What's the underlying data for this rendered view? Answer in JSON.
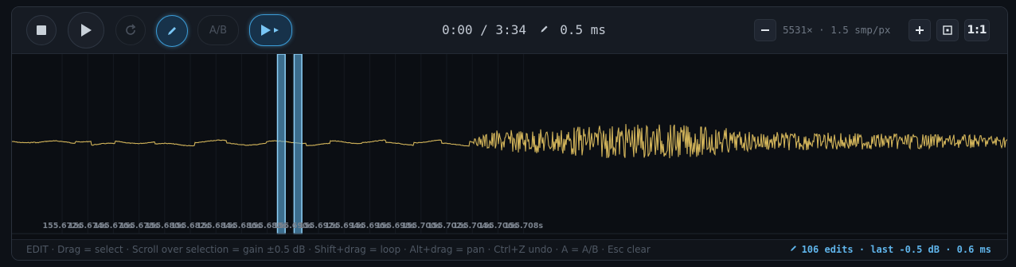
{
  "toolbar": {
    "ab_label": "A/B",
    "time": "0:00 / 3:34",
    "edit_step": "0.5 ms",
    "zoom_label": "5531× · 1.5 smp/px",
    "one_to_one_label": "1:1"
  },
  "icons": {
    "stop": "stop-icon",
    "play": "play-icon",
    "loop": "loop-icon",
    "pencil": "pencil-icon",
    "play_next": "play-next-icon",
    "minus": "minus-icon",
    "plus": "plus-icon",
    "fit": "fit-icon"
  },
  "colors": {
    "waveform": "#d2b45a",
    "selection": "#5aa8d8",
    "accent": "#58b4f0",
    "background": "#0b0e13"
  },
  "chart_data": {
    "type": "line",
    "x_unit": "s",
    "tick_labels": [
      "155.672s",
      "155.674s",
      "155.676s",
      "155.678s",
      "155.680s",
      "155.682s",
      "155.684s",
      "155.686s",
      "155.688s",
      "155.690s",
      "155.692s",
      "155.694s",
      "155.696s",
      "155.698s",
      "155.700s",
      "155.702s",
      "155.704s",
      "155.706s",
      "155.708s"
    ],
    "selections": [
      {
        "start": 155.6888,
        "end": 155.6894
      },
      {
        "start": 155.6901,
        "end": 155.6907
      }
    ]
  },
  "status": {
    "hint": "EDIT · Drag = select · Scroll over selection = gain ±0.5 dB · Shift+drag = loop · Alt+drag = pan · Ctrl+Z undo · A = A/B · Esc clear",
    "edits": "106 edits · last -0.5 dB · 0.6 ms"
  }
}
